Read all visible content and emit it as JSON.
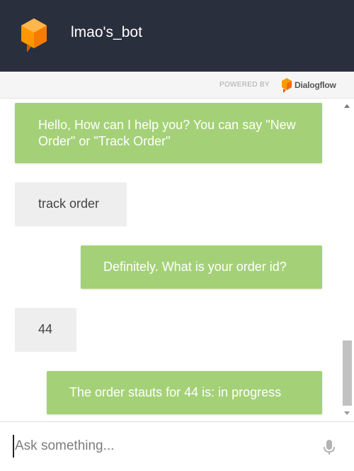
{
  "header": {
    "title": "lmao's_bot",
    "logo_icon": "bot-cube-icon",
    "background": "#2a2f3d"
  },
  "powered_by": {
    "label": "POWERED BY",
    "brand": "Dialogflow",
    "brand_icon": "dialogflow-logo-icon"
  },
  "messages": [
    {
      "sender": "bot",
      "text": "Hello, How can I help you? You can say \"New Order\" or \"Track Order\""
    },
    {
      "sender": "user",
      "text": "track order"
    },
    {
      "sender": "bot",
      "text": "Definitely. What is your order id?"
    },
    {
      "sender": "user",
      "text": "44"
    },
    {
      "sender": "bot",
      "text": "The order stauts for 44 is: in progress"
    }
  ],
  "input": {
    "placeholder": "Ask something...",
    "value": "",
    "mic_icon": "microphone-icon"
  },
  "colors": {
    "bot_bubble": "#a4d177",
    "user_bubble": "#eeeeee",
    "accent": "#f57c00"
  }
}
